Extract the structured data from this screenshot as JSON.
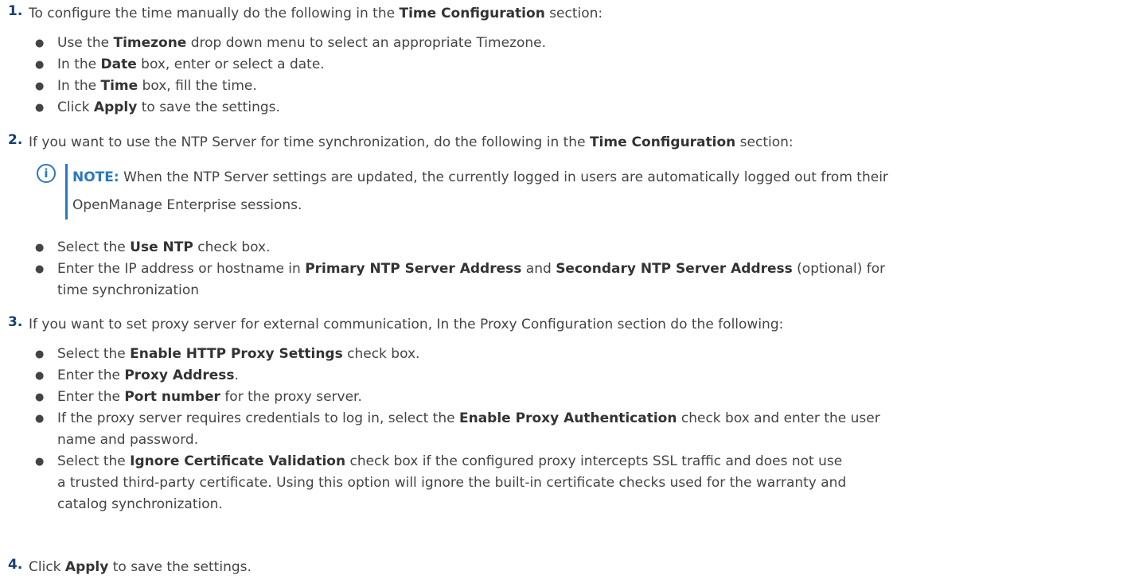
{
  "steps": [
    {
      "number": "1.",
      "parts": [
        "To configure the time manually do the following in the ",
        "Time Configuration",
        " section:"
      ],
      "bullets": [
        [
          "Use the ",
          "Timezone",
          " drop down menu to select an appropriate Timezone."
        ],
        [
          "In the ",
          "Date",
          " box, enter or select a date."
        ],
        [
          "In the ",
          "Time",
          " box, fill the time."
        ],
        [
          "Click ",
          "Apply",
          " to save the settings."
        ]
      ]
    },
    {
      "number": "2.",
      "parts": [
        "If you want to use the NTP Server for time synchronization, do the following in the ",
        "Time Configuration",
        " section:"
      ],
      "note": {
        "label": "NOTE:",
        "text_line1": "When the NTP Server settings are updated, the currently logged in users are automatically logged out from their",
        "text_line2": "OpenManage Enterprise sessions."
      },
      "bullets": [
        [
          "Select the ",
          "Use NTP",
          " check box."
        ],
        [
          "Enter the IP address or hostname in ",
          "Primary NTP Server Address",
          " and ",
          "Secondary NTP Server Address",
          " (optional) for"
        ],
        [
          "time synchronization"
        ]
      ]
    },
    {
      "number": "3.",
      "parts": [
        "If you want to set proxy server for external communication, In the Proxy Configuration section do the following:"
      ],
      "bullets": [
        [
          "Select the ",
          "Enable HTTP Proxy Settings",
          " check box."
        ],
        [
          "Enter the ",
          "Proxy Address",
          "."
        ],
        [
          "Enter the ",
          "Port number",
          " for the proxy server."
        ],
        [
          "If the proxy server requires credentials to log in, select the ",
          "Enable Proxy Authentication",
          " check box and enter the user"
        ],
        [
          "name and password."
        ],
        [
          "Select the ",
          "Ignore Certificate Validation",
          " check box if the configured proxy intercepts SSL traffic and does not use"
        ],
        [
          "a trusted third-party certificate. Using this option will ignore the built-in certificate checks used for the warranty and"
        ],
        [
          "catalog synchronization."
        ]
      ]
    },
    {
      "number": "4.",
      "parts": [
        "Click ",
        "Apply",
        " to save the settings."
      ]
    }
  ],
  "bullet_glyph": "●",
  "note_icon_glyph": "i"
}
